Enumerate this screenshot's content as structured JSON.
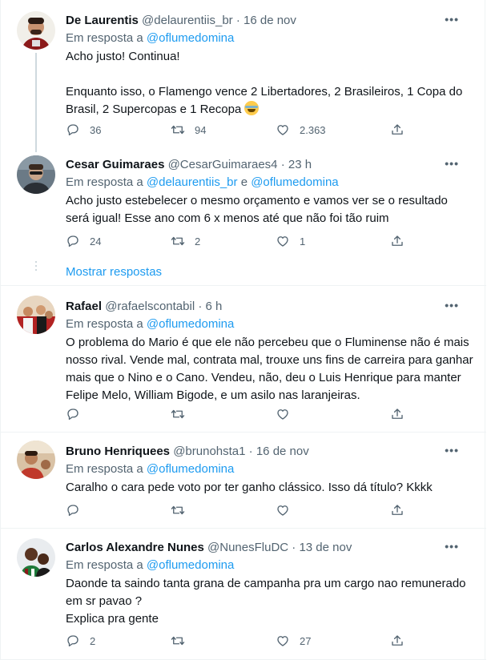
{
  "tweets": [
    {
      "name": "De Laurentis",
      "handle": "@delaurentiis_br",
      "dot": "·",
      "time": "16 de nov",
      "reply_prefix": "Em resposta a",
      "reply_to_1": "@oflumedomina",
      "reply_join": "",
      "reply_to_2": "",
      "text_1": "Acho justo! Continua!\n\nEnquanto isso, o Flamengo vence 2 Libertadores, 2 Brasileiros, 1 Copa do Brasil, 2 Supercopas e 1 Recopa",
      "emoji": "face-with-tears-of-joy",
      "replies": "36",
      "retweets": "94",
      "likes": "2.363",
      "avatar_color": "#7a2a2a"
    },
    {
      "name": "Cesar Guimaraes",
      "handle": "@CesarGuimaraes4",
      "dot": "·",
      "time": "23 h",
      "reply_prefix": "Em resposta a",
      "reply_to_1": "@delaurentiis_br",
      "reply_join": "e",
      "reply_to_2": "@oflumedomina",
      "text_1": "Acho justo estebelecer o mesmo orçamento e vamos ver se o resultado será igual! Esse ano com 6 x menos até que não foi tão ruim",
      "replies": "24",
      "retweets": "2",
      "likes": "1",
      "avatar_color": "#4a4038"
    },
    {
      "name": "Rafael",
      "handle": "@rafaelscontabil",
      "dot": "·",
      "time": "6 h",
      "reply_prefix": "Em resposta a",
      "reply_to_1": "@oflumedomina",
      "reply_join": "",
      "reply_to_2": "",
      "text_1": "O problema do Mario é que ele não percebeu que o Fluminense não é mais nosso rival. Vende mal, contrata mal, trouxe uns fins de carreira para ganhar mais que o Nino e o Cano. Vendeu, não, deu o Luis Henrique para manter Felipe Melo, William Bigode, e um asilo nas laranjeiras.",
      "replies": "",
      "retweets": "",
      "likes": "",
      "avatar_color": "#c9a27a"
    },
    {
      "name": "Bruno Henriquees",
      "handle": "@brunohsta1",
      "dot": "·",
      "time": "16 de nov",
      "reply_prefix": "Em resposta a",
      "reply_to_1": "@oflumedomina",
      "reply_join": "",
      "reply_to_2": "",
      "text_1": "Caralho o cara pede voto por ter ganho clássico. Isso dá título? Kkkk",
      "replies": "",
      "retweets": "",
      "likes": "",
      "avatar_color": "#b98a6a"
    },
    {
      "name": "Carlos Alexandre Nunes",
      "handle": "@NunesFluDC",
      "dot": "·",
      "time": "13 de nov",
      "reply_prefix": "Em resposta a",
      "reply_to_1": "@oflumedomina",
      "reply_join": "",
      "reply_to_2": "",
      "text_1": "Daonde ta saindo tanta grana de campanha pra um cargo nao remunerado em sr pavao ?\nExplica pra gente",
      "replies": "2",
      "retweets": "",
      "likes": "27",
      "avatar_color": "#5a3a2a"
    }
  ],
  "show_replies": "Mostrar respostas",
  "more_glyph": "•••"
}
